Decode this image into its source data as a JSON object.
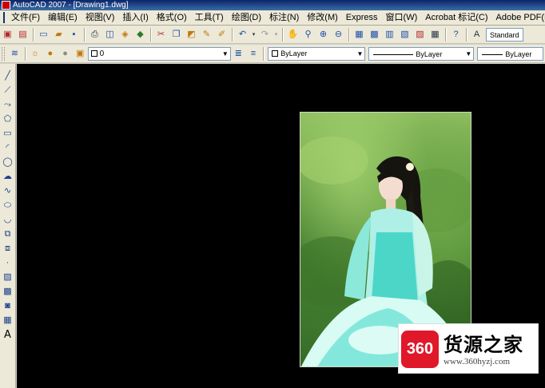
{
  "window": {
    "title": "AutoCAD 2007 - [Drawing1.dwg]"
  },
  "menu": [
    "文件(F)",
    "编辑(E)",
    "视图(V)",
    "插入(I)",
    "格式(O)",
    "工具(T)",
    "绘图(D)",
    "标注(N)",
    "修改(M)",
    "Express",
    "窗口(W)",
    "Acrobat 标记(C)",
    "Adobe PDF(B)"
  ],
  "toolbar": {
    "text_style": "Standard"
  },
  "layers": {
    "current_layer": "0"
  },
  "properties": {
    "color": "ByLayer",
    "linetype": "ByLayer",
    "lineweight": "ByLayer"
  },
  "tool_icons": {
    "standard": [
      "new-icon",
      "open-icon",
      "save-icon",
      "plot-icon",
      "plot-preview-icon",
      "publish-icon",
      "3d-dwf-icon",
      "cut-icon",
      "copy-icon",
      "paste-icon",
      "match-properties-icon",
      "block-editor-icon",
      "undo-icon",
      "redo-icon",
      "pan-icon",
      "zoom-realtime-icon",
      "zoom-window-icon",
      "zoom-previous-icon",
      "properties-icon",
      "design-center-icon",
      "tool-palettes-icon",
      "sheet-set-icon",
      "markup-icon",
      "calculator-icon",
      "help-icon"
    ],
    "draw": [
      "line-icon",
      "construction-line-icon",
      "polyline-icon",
      "polygon-icon",
      "rectangle-icon",
      "arc-icon",
      "circle-icon",
      "revision-cloud-icon",
      "spline-icon",
      "ellipse-icon",
      "ellipse-arc-icon",
      "insert-block-icon",
      "make-block-icon",
      "point-icon",
      "hatch-icon",
      "gradient-icon",
      "region-icon",
      "table-icon",
      "multiline-text-icon"
    ]
  },
  "watermark": {
    "logo_text": "360",
    "title": "货源之家",
    "url": "www.360hyzj.com"
  }
}
